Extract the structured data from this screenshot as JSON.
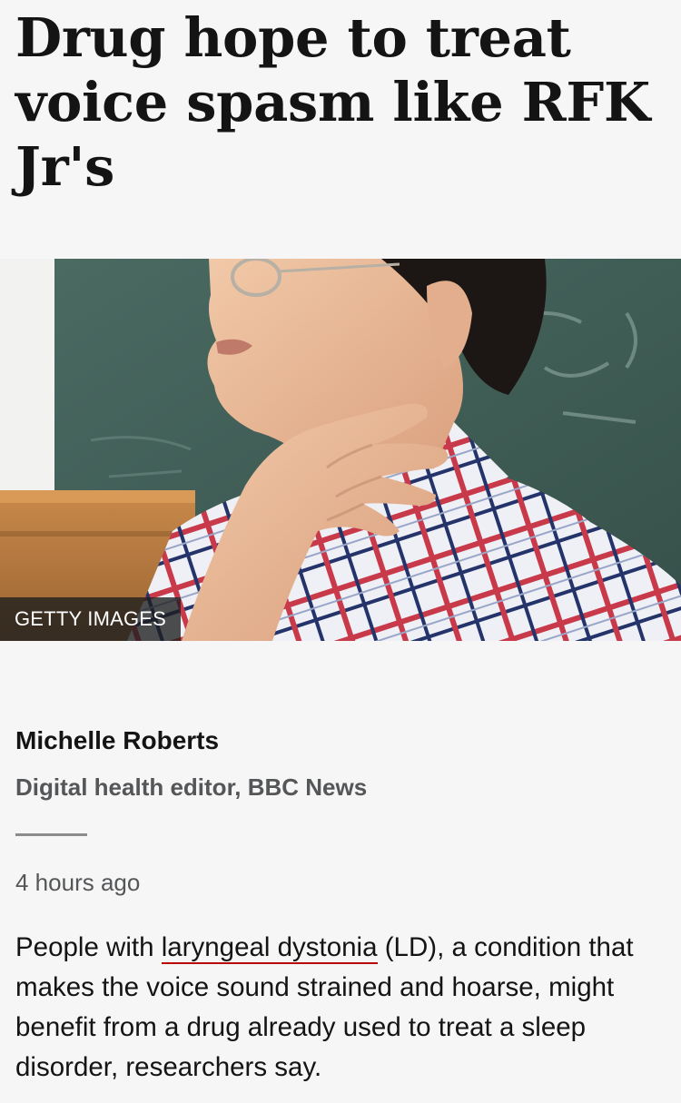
{
  "article": {
    "headline": "Drug hope to treat voice spasm like RFK Jr's",
    "image": {
      "credit": "GETTY IMAGES",
      "subject": "man with hand on throat in front of chalkboard"
    },
    "byline": {
      "name": "Michelle Roberts",
      "role": "Digital health editor, BBC News"
    },
    "timestamp": "4 hours ago",
    "lede": {
      "before_link": "People with ",
      "link_text": "laryngeal dystonia",
      "after_link": " (LD), a condition that makes the voice sound strained and hoarse, might benefit from a drug already used to treat a sleep disorder, researchers say."
    }
  },
  "colors": {
    "background": "#f6f6f6",
    "text": "#141414",
    "secondary_text": "#545658",
    "link_underline": "#b80000"
  }
}
